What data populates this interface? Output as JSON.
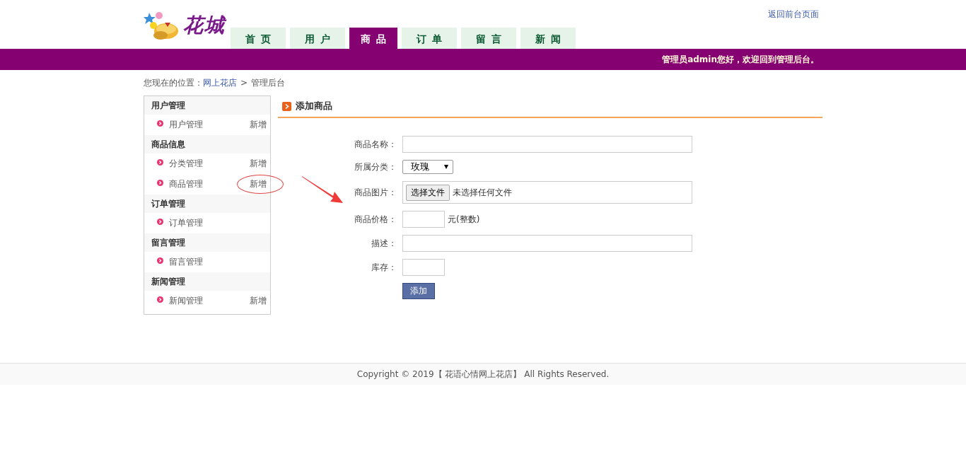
{
  "header": {
    "logo_text": "花城",
    "top_link": "返回前台页面",
    "nav_tabs": [
      {
        "label": "首页",
        "selected": false
      },
      {
        "label": "用户",
        "selected": false
      },
      {
        "label": "商品",
        "selected": true
      },
      {
        "label": "订单",
        "selected": false
      },
      {
        "label": "留言",
        "selected": false
      },
      {
        "label": "新闻",
        "selected": false
      }
    ],
    "welcome": "管理员admin您好，欢迎回到管理后台。"
  },
  "breadcrumb": {
    "prefix": "您现在的位置：",
    "link": "网上花店",
    "separator": ">",
    "current": "管理后台"
  },
  "sidebar": {
    "sections": [
      {
        "title": "用户管理",
        "items": [
          {
            "label": "用户管理",
            "action": "新增",
            "annotated": false
          }
        ]
      },
      {
        "title": "商品信息",
        "items": [
          {
            "label": "分类管理",
            "action": "新增",
            "annotated": false
          },
          {
            "label": "商品管理",
            "action": "新增",
            "annotated": true
          }
        ]
      },
      {
        "title": "订单管理",
        "items": [
          {
            "label": "订单管理",
            "annotated": false
          }
        ]
      },
      {
        "title": "留言管理",
        "items": [
          {
            "label": "留言管理",
            "annotated": false
          }
        ]
      },
      {
        "title": "新闻管理",
        "items": [
          {
            "label": "新闻管理",
            "action": "新增",
            "annotated": false
          }
        ]
      }
    ]
  },
  "form": {
    "title": "添加商品",
    "fields": [
      {
        "kind": "text",
        "label": "商品名称："
      },
      {
        "kind": "select",
        "label": "所属分类：",
        "value": "玫瑰"
      },
      {
        "kind": "file",
        "label": "商品图片：",
        "button": "选择文件",
        "status": "未选择任何文件"
      },
      {
        "kind": "short",
        "label": "商品价格：",
        "suffix": "元(整数)"
      },
      {
        "kind": "text",
        "label": "描述："
      },
      {
        "kind": "short",
        "label": "库存："
      }
    ],
    "submit": "添加"
  },
  "footer": "Copyright © 2019【 花语心情网上花店】 All Rights Reserved."
}
